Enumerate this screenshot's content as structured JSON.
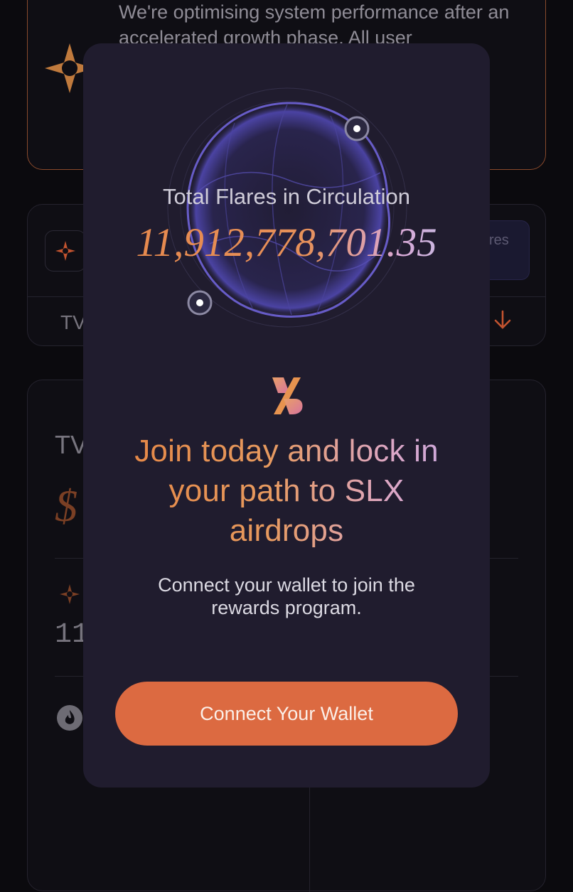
{
  "background": {
    "notice_text": "We're optimising system performance after an accelerated growth phase. All user",
    "stats_pill_text": "res",
    "stats_tv_label": "TV",
    "tvl_label": "TV",
    "tvl_dollar": "$",
    "tvl_number": "11"
  },
  "modal": {
    "total_label": "Total Flares in Circulation",
    "total_value": "11,912,778,701.35",
    "logo_icon": "slx-logo-icon",
    "headline": "Join today and lock in your path to SLX airdrops",
    "subtext": "Connect your wallet to join the rewards program.",
    "cta_label": "Connect Your Wallet"
  },
  "colors": {
    "modal_bg": "#201c2e",
    "accent": "#dc6a41",
    "globe": "#6f63d9"
  }
}
